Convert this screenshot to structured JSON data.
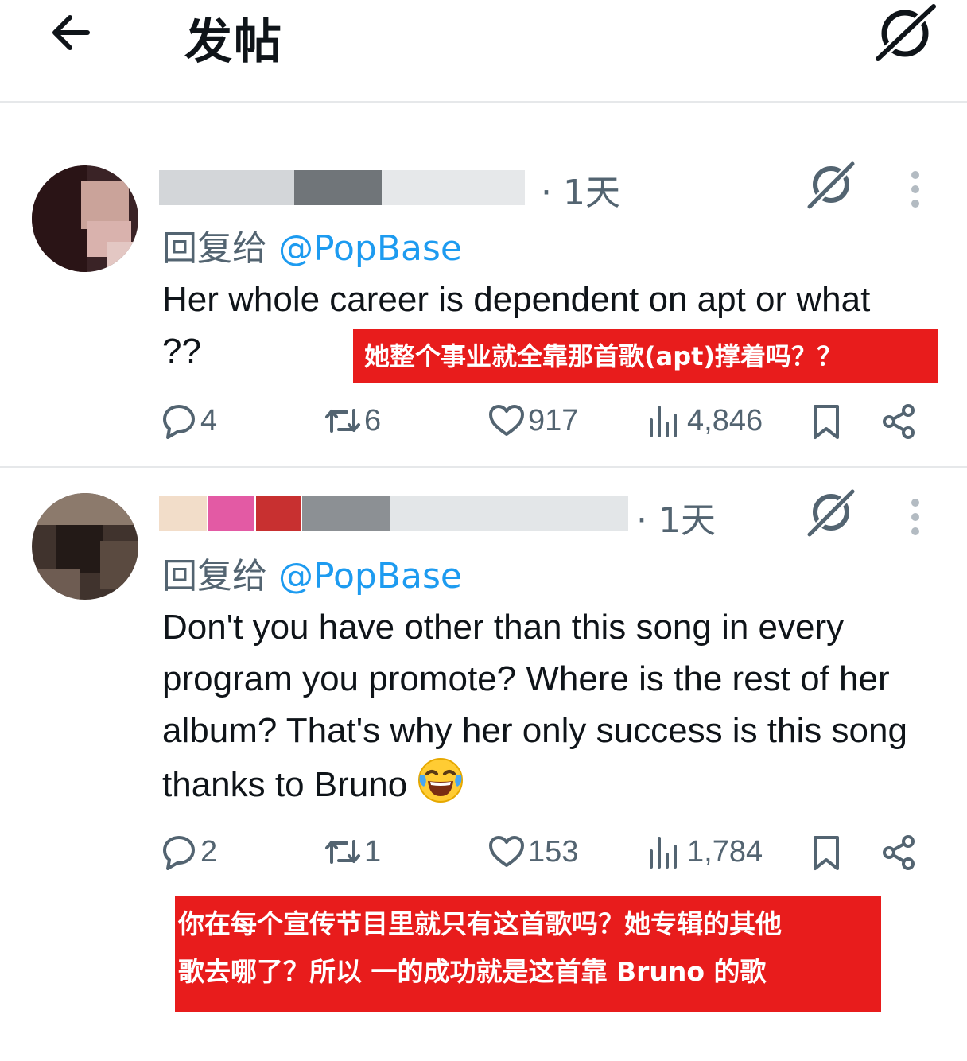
{
  "header": {
    "title": "发帖"
  },
  "tweets": [
    {
      "time": "· 1天",
      "reply_label": "回复给",
      "reply_handle": "@PopBase",
      "text": "Her whole career is dependent on apt or what ??",
      "stats": {
        "replies": "4",
        "reposts": "6",
        "likes": "917",
        "views": "4,846"
      },
      "overlay": [
        "她整个事业就全靠那首歌(apt)撑着吗？？"
      ]
    },
    {
      "time": "· 1天",
      "reply_label": "回复给",
      "reply_handle": "@PopBase",
      "text": "Don't you have other than this song in every program you promote? Where is the rest of her album? That's why her only success is this song thanks to Bruno",
      "emoji": "face-with-tears-of-joy",
      "stats": {
        "replies": "2",
        "reposts": "1",
        "likes": "153",
        "views": "1,784"
      },
      "overlay": [
        "你在每个宣传节目里就只有这首歌吗？她专辑的其他",
        "歌去哪了？所以  一的成功就是这首靠 Bruno 的歌"
      ]
    }
  ],
  "colors": {
    "link": "#1d9bf0",
    "muted": "#536471",
    "overlay": "#e81c1c"
  }
}
